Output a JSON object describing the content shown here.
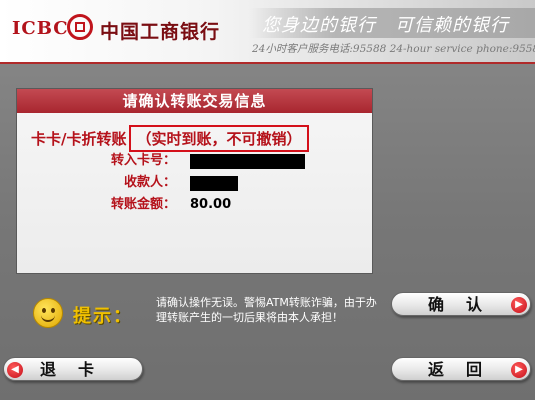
{
  "header": {
    "brand_abbr": "ICBC",
    "bank_name": "中国工商银行",
    "slogan": "您身边的银行　可信赖的银行",
    "hotline": "24小时客户服务电话:95588  24-hour service phone:95588"
  },
  "panel": {
    "title": "请确认转账交易信息",
    "transfer_type": "卡卡/卡折转账",
    "transfer_note": "（实时到账，不可撤销）",
    "fields": [
      {
        "label": "转入卡号：",
        "value": ""
      },
      {
        "label": "收款人：",
        "value": ""
      },
      {
        "label": "转账金额：",
        "value": "80.00"
      }
    ]
  },
  "prompt": {
    "label": "提示：",
    "message": "请确认操作无误。警惕ATM转账诈骗，由于办理转账产生的一切后果将由本人承担！"
  },
  "buttons": {
    "confirm": "确认",
    "exit_card": "退卡",
    "back": "返回"
  },
  "icons": {
    "left_arrow": "arrow-left-circle-icon",
    "right_arrow": "arrow-right-circle-icon",
    "smiley": "smiley-icon"
  },
  "colors": {
    "brand_red": "#b2131b",
    "panel_title": "#a8262f",
    "tip_yellow": "#f0c000"
  }
}
